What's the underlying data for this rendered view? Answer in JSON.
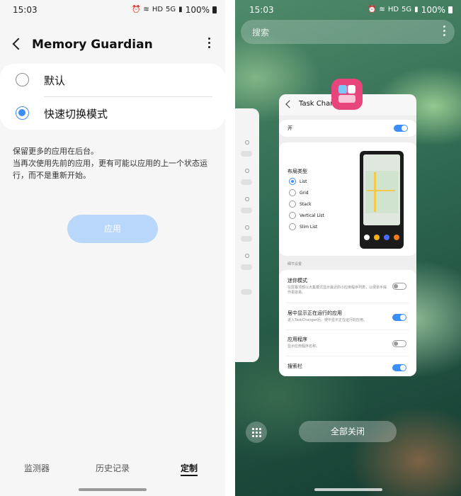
{
  "left": {
    "status": {
      "time": "15:03",
      "battery": "100%",
      "net1": "HD",
      "net2": "5G"
    },
    "appbar": {
      "title": "Memory Guardian"
    },
    "options": [
      {
        "label": "默认",
        "selected": false
      },
      {
        "label": "快速切换模式",
        "selected": true
      }
    ],
    "description": "保留更多的应用在后台。\n当再次使用先前的应用，更有可能以应用的上一个状态运行，而不是重新开始。",
    "apply_label": "应用",
    "tabs": [
      {
        "label": "监测器",
        "active": false
      },
      {
        "label": "历史记录",
        "active": false
      },
      {
        "label": "定制",
        "active": true
      }
    ]
  },
  "right": {
    "status": {
      "time": "15:03",
      "battery": "100%",
      "net1": "HD",
      "net2": "5G"
    },
    "search_placeholder": "搜索",
    "card": {
      "title": "Task Changer",
      "toggle_on_label": "开",
      "layout_title": "布局类型",
      "layout_options": [
        {
          "label": "List",
          "selected": true
        },
        {
          "label": "Grid",
          "selected": false
        },
        {
          "label": "Stack",
          "selected": false
        },
        {
          "label": "Vertical List",
          "selected": false
        },
        {
          "label": "Slim List",
          "selected": false
        }
      ],
      "section_header": "细节设置",
      "settings": [
        {
          "title": "迷你模式",
          "sub": "在屏幕顶部以大集模式显示最近的小应用程序列表，以便单手操作更容易。",
          "on": false
        },
        {
          "title": "居中显示正在运行的应用",
          "sub": "进入TaskChanger后，使中显示正在运行的应用。",
          "on": true
        },
        {
          "title": "应用程序",
          "sub": "显示应用程序名称。",
          "on": false
        },
        {
          "title": "搜索栏",
          "sub": "",
          "on": true
        }
      ]
    },
    "close_all_label": "全部关闭"
  },
  "colors": {
    "accent": "#3e8ef7",
    "apply_disabled": "#b9d6fb",
    "app_icon": "#e8457c"
  }
}
